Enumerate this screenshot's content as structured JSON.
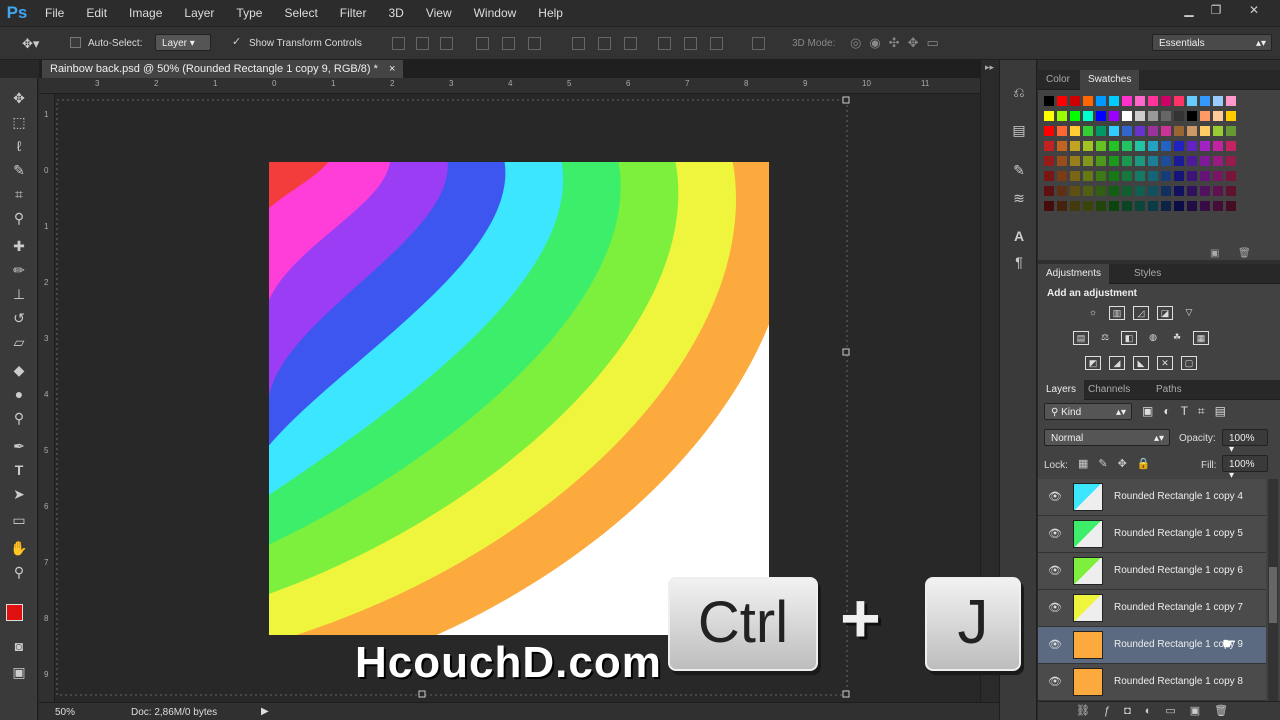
{
  "app": {
    "logo": "Ps",
    "menu": [
      "File",
      "Edit",
      "Image",
      "Layer",
      "Type",
      "Select",
      "Filter",
      "3D",
      "View",
      "Window",
      "Help"
    ]
  },
  "options": {
    "auto_select_label": "Auto-Select:",
    "auto_select_value": "Layer",
    "show_transform_label": "Show Transform Controls",
    "mode_label": "3D Mode:",
    "workspace": "Essentials"
  },
  "document": {
    "tab_title": "Rainbow back.psd @ 50% (Rounded Rectangle 1 copy 9, RGB/8) *",
    "close": "×"
  },
  "rulers": {
    "top": [
      "3",
      "2",
      "1",
      "0",
      "1",
      "2",
      "3",
      "4",
      "5",
      "6",
      "7",
      "8",
      "9",
      "10",
      "11"
    ],
    "left": [
      "1",
      "0",
      "1",
      "2",
      "3",
      "4",
      "5",
      "6",
      "7",
      "8",
      "9"
    ]
  },
  "status": {
    "zoom": "50%",
    "doc": "Doc: 2,86M/0 bytes"
  },
  "colors": {
    "rainbow": [
      "#f33d3d",
      "#ff3dd8",
      "#9a3df5",
      "#3d56ef",
      "#3de6ff",
      "#3dee6a",
      "#7df03d",
      "#eff53d",
      "#fca93d"
    ],
    "foreground": "#e01010",
    "background": "#000000"
  },
  "panels": {
    "color_tab": "Color",
    "swatches_tab": "Swatches",
    "adjustments_tab": "Adjustments",
    "styles_tab": "Styles",
    "add_adjustment": "Add an adjustment",
    "layers_tab": "Layers",
    "channels_tab": "Channels",
    "paths_tab": "Paths",
    "filter_kind": "Kind",
    "blend_mode": "Normal",
    "opacity_label": "Opacity:",
    "opacity_value": "100%",
    "lock_label": "Lock:",
    "fill_label": "Fill:",
    "fill_value": "100%",
    "layers": [
      {
        "name": "Rounded Rectangle 1 copy 4",
        "color": "#3de6ff"
      },
      {
        "name": "Rounded Rectangle 1 copy 5",
        "color": "#3dee6a"
      },
      {
        "name": "Rounded Rectangle 1 copy 6",
        "color": "#7df03d"
      },
      {
        "name": "Rounded Rectangle 1 copy 7",
        "color": "#eff53d"
      },
      {
        "name": "Rounded Rectangle 1 copy 9",
        "color": "#fca93d"
      },
      {
        "name": "Rounded Rectangle 1 copy 8",
        "color": "#fca93d"
      }
    ]
  },
  "overlay": {
    "key1": "Ctrl",
    "plus": "+",
    "key2": "J",
    "watermark": "HcouchD.com"
  }
}
